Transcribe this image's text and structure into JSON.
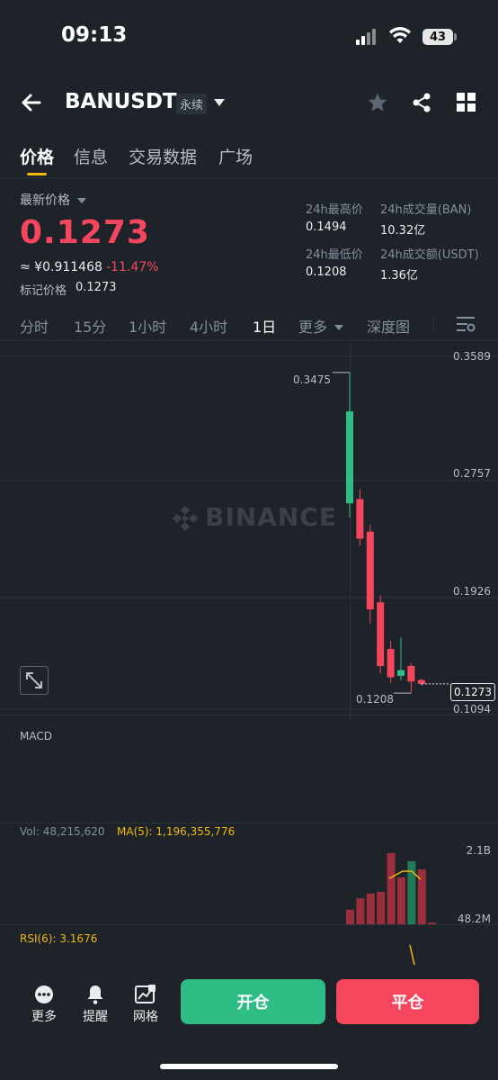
{
  "status_bar": {
    "time": "09:13",
    "battery": "43"
  },
  "header": {
    "symbol": "BANUSDT",
    "contract_type": "永续"
  },
  "tabs": [
    {
      "label": "价格",
      "active": true
    },
    {
      "label": "信息",
      "active": false
    },
    {
      "label": "交易数据",
      "active": false
    },
    {
      "label": "广场",
      "active": false
    }
  ],
  "price_info": {
    "latest_label": "最新价格",
    "latest_price": "0.1273",
    "cny_value": "≈ ¥0.911468",
    "change_pct": "-11.47%",
    "mark_label": "标记价格",
    "mark_value": "0.1273"
  },
  "stats": {
    "high_label": "24h最高价",
    "high_value": "0.1494",
    "vol_label": "24h成交量(BAN)",
    "vol_value": "10.32亿",
    "low_label": "24h最低价",
    "low_value": "0.1208",
    "turnover_label": "24h成交额(USDT)",
    "turnover_value": "1.36亿"
  },
  "timeframes": [
    {
      "label": "分时",
      "active": false
    },
    {
      "label": "15分",
      "active": false
    },
    {
      "label": "1小时",
      "active": false
    },
    {
      "label": "4小时",
      "active": false
    },
    {
      "label": "1日",
      "active": true
    },
    {
      "label": "更多",
      "active": false
    },
    {
      "label": "深度图",
      "active": false
    }
  ],
  "chart": {
    "watermark": "BINANCE",
    "price_axis": [
      "0.3589",
      "0.2757",
      "0.1926",
      "0.1094"
    ],
    "high_marker": "0.3475",
    "low_marker": "0.1208",
    "current_price_tag": "0.1273"
  },
  "chart_data": {
    "type": "candlestick",
    "ylim": [
      0.1094,
      0.3589
    ],
    "candles": [
      {
        "open": 0.255,
        "close": 0.32,
        "high": 0.3475,
        "low": 0.245
      },
      {
        "open": 0.258,
        "close": 0.23,
        "high": 0.265,
        "low": 0.225
      },
      {
        "open": 0.235,
        "close": 0.18,
        "high": 0.24,
        "low": 0.17
      },
      {
        "open": 0.185,
        "close": 0.14,
        "high": 0.19,
        "low": 0.135
      },
      {
        "open": 0.152,
        "close": 0.132,
        "high": 0.158,
        "low": 0.128
      },
      {
        "open": 0.133,
        "close": 0.137,
        "high": 0.16,
        "low": 0.13
      },
      {
        "open": 0.14,
        "close": 0.129,
        "high": 0.142,
        "low": 0.1208
      },
      {
        "open": 0.13,
        "close": 0.1273,
        "high": 0.131,
        "low": 0.126
      }
    ],
    "volume_axis": [
      "2.1B",
      "48.2M"
    ],
    "volumes": [
      0.18,
      0.32,
      0.38,
      0.4,
      0.88,
      0.58,
      0.78,
      0.68,
      0.02
    ],
    "volume_up": [
      false,
      false,
      false,
      false,
      false,
      false,
      true,
      false,
      false
    ]
  },
  "indicators": {
    "macd_label": "MACD",
    "vol_label": "Vol: 48,215,620",
    "ma5_label": "MA(5): 1,196,355,776",
    "rsi_label": "RSI(6): 3.1676"
  },
  "bottom_bar": {
    "more": "更多",
    "alert": "提醒",
    "grid": "网格",
    "open_btn": "开仓",
    "close_btn": "平仓"
  },
  "colors": {
    "up": "#2ebd85",
    "down": "#f6465d",
    "accent": "#f0b90b",
    "bg": "#1e2329"
  }
}
